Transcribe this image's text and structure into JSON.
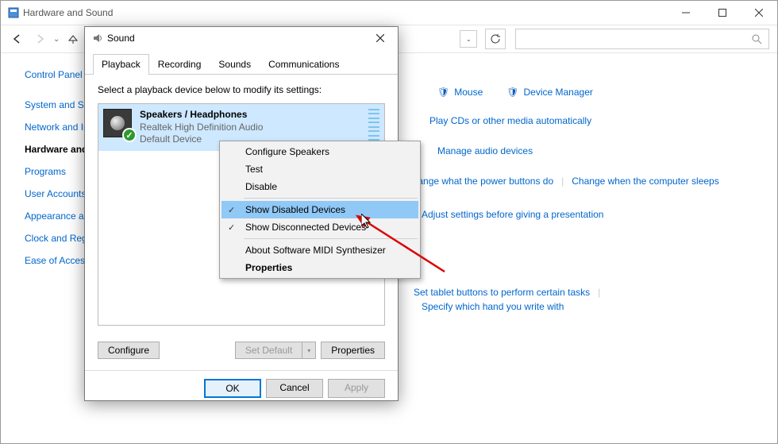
{
  "cp": {
    "title": "Hardware and Sound",
    "side": {
      "home": "Control Panel Home",
      "items": [
        "System and Security",
        "Network and Internet",
        "Hardware and Sound",
        "Programs",
        "User Accounts",
        "Appearance and Personalization",
        "Clock and Region",
        "Ease of Access"
      ],
      "current_index": 2
    },
    "links": {
      "row1": [
        {
          "label": "Mouse",
          "shield": true
        },
        {
          "label": "Device Manager",
          "shield": true
        }
      ],
      "l2": "Play CDs or other media automatically",
      "l3": "Manage audio devices",
      "l4a": "Change what the power buttons do",
      "l4b": "Change when the computer sleeps",
      "l5": "Adjust settings before giving a presentation",
      "l6a": "Set tablet buttons to perform certain tasks",
      "l6b": "Specify which hand you write with"
    }
  },
  "sound": {
    "title": "Sound",
    "tabs": [
      "Playback",
      "Recording",
      "Sounds",
      "Communications"
    ],
    "active_tab": 0,
    "instruction": "Select a playback device below to modify its settings:",
    "device": {
      "name": "Speakers / Headphones",
      "driver": "Realtek High Definition Audio",
      "status": "Default Device"
    },
    "buttons": {
      "configure": "Configure",
      "set_default": "Set Default",
      "properties": "Properties",
      "ok": "OK",
      "cancel": "Cancel",
      "apply": "Apply"
    }
  },
  "ctx": {
    "items": [
      {
        "label": "Configure Speakers"
      },
      {
        "label": "Test"
      },
      {
        "label": "Disable"
      },
      {
        "sep": true
      },
      {
        "label": "Show Disabled Devices",
        "checked": true,
        "selected": true
      },
      {
        "label": "Show Disconnected Devices",
        "checked": true
      },
      {
        "sep": true
      },
      {
        "label": "About Software MIDI Synthesizer"
      },
      {
        "label": "Properties",
        "bold": true
      }
    ]
  }
}
